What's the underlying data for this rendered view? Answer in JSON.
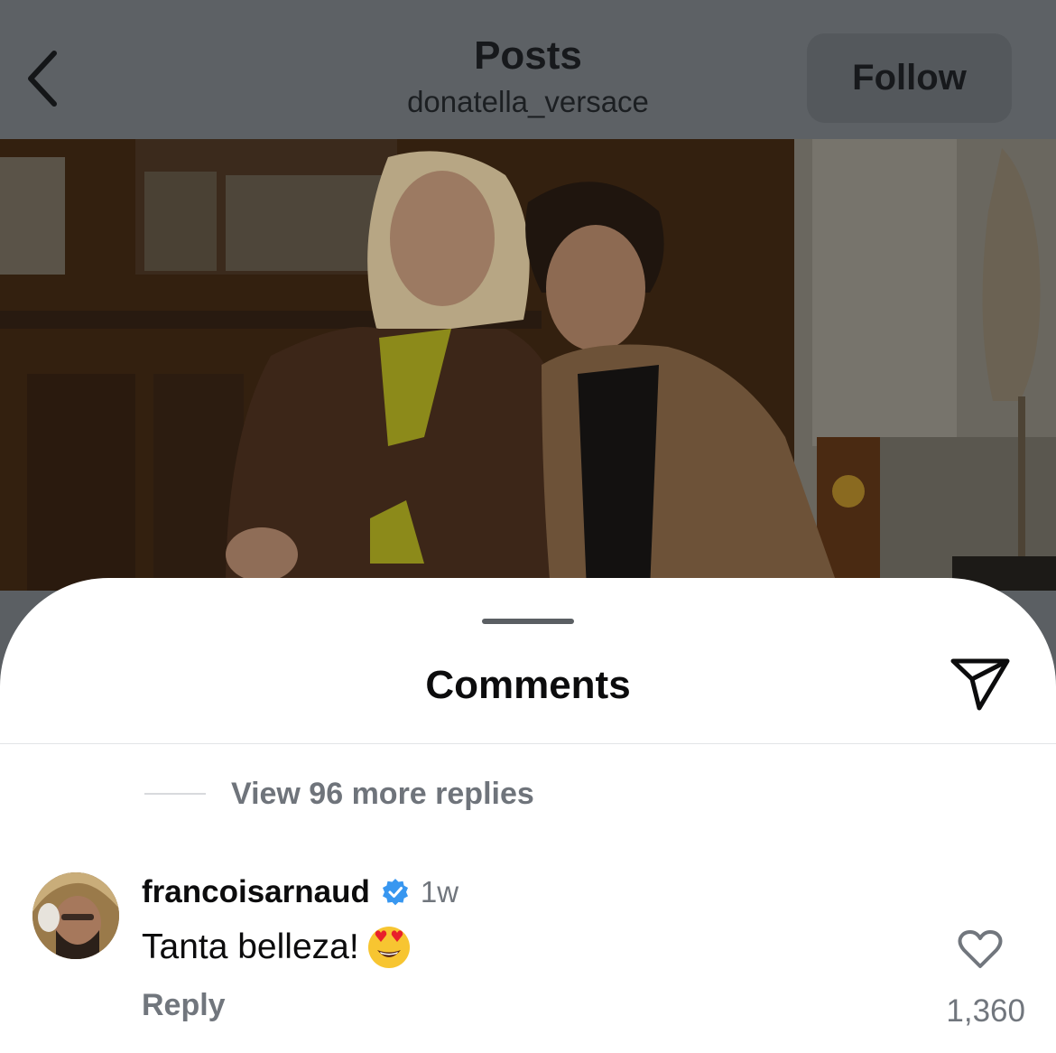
{
  "header": {
    "title": "Posts",
    "username": "donatella_versace",
    "follow_label": "Follow",
    "back_icon": "chevron-left-icon"
  },
  "sheet": {
    "title": "Comments",
    "share_icon": "send-icon",
    "view_replies": "View 96 more replies"
  },
  "comment": {
    "username": "francoisarnaud",
    "verified": true,
    "time": "1w",
    "text": "Tanta belleza!",
    "emoji": "heart-eyes-emoji",
    "reply_label": "Reply",
    "like_icon": "heart-icon",
    "like_count": "1,360"
  },
  "colors": {
    "verified_blue": "#3897f0",
    "muted_text": "#71767d",
    "overlay": "#5d6165"
  }
}
